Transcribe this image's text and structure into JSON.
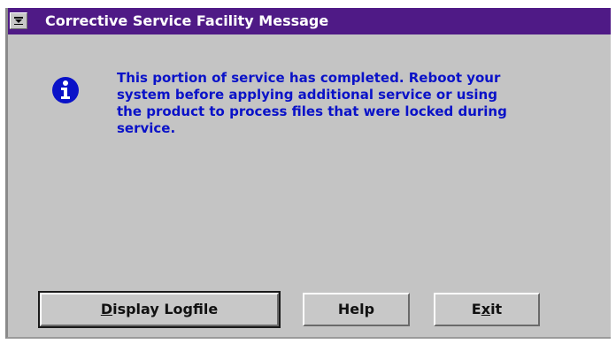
{
  "window": {
    "title": "Corrective Service Facility Message",
    "system_menu_icon": "system-menu-icon"
  },
  "message": {
    "icon": "information-icon",
    "text": "This portion of service has completed.  Reboot your\nsystem before applying additional service or using\nthe product to process files that were locked during\nservice."
  },
  "buttons": [
    {
      "label": "Display Logfile",
      "mnemonic": "D",
      "rest": "isplay Logfile",
      "default": true
    },
    {
      "label": "Help",
      "default": false
    },
    {
      "label": "Exit",
      "pre": "E",
      "mnemonic": "x",
      "rest": "it",
      "default": false
    }
  ],
  "colors": {
    "titlebar": "#4f1a86",
    "dialog_background": "#c4c4c4",
    "message_text": "#0a12c8",
    "icon": "#0a12c8"
  }
}
